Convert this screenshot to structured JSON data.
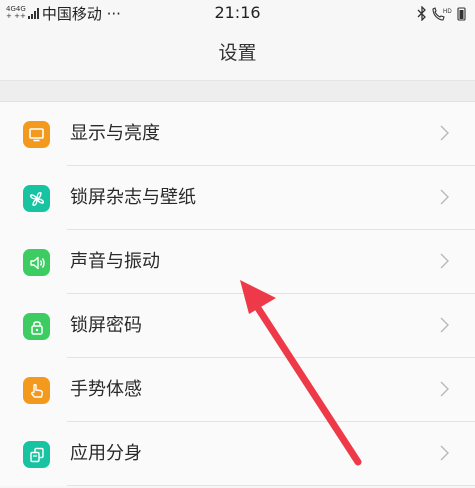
{
  "status_bar": {
    "net_type_top": "4G4G",
    "net_type_bottom": "+ ++",
    "carrier": "中国移动 ···",
    "time": "21:16",
    "icons": [
      "bluetooth-icon",
      "hd-call-icon"
    ]
  },
  "header": {
    "title": "设置"
  },
  "settings": {
    "items": [
      {
        "label": "显示与亮度",
        "icon": "display-icon",
        "color": "#f39a1e"
      },
      {
        "label": "锁屏杂志与壁纸",
        "icon": "pinwheel-icon",
        "color": "#17c3a1"
      },
      {
        "label": "声音与振动",
        "icon": "speaker-icon",
        "color": "#3ccc62"
      },
      {
        "label": "锁屏密码",
        "icon": "lock-icon",
        "color": "#3ccc62"
      },
      {
        "label": "手势体感",
        "icon": "hand-icon",
        "color": "#f39a1e"
      },
      {
        "label": "应用分身",
        "icon": "clone-app-icon",
        "color": "#17c3a1"
      }
    ]
  },
  "annotation": {
    "arrow_color": "#ee3a48",
    "points_to": "声音与振动"
  }
}
